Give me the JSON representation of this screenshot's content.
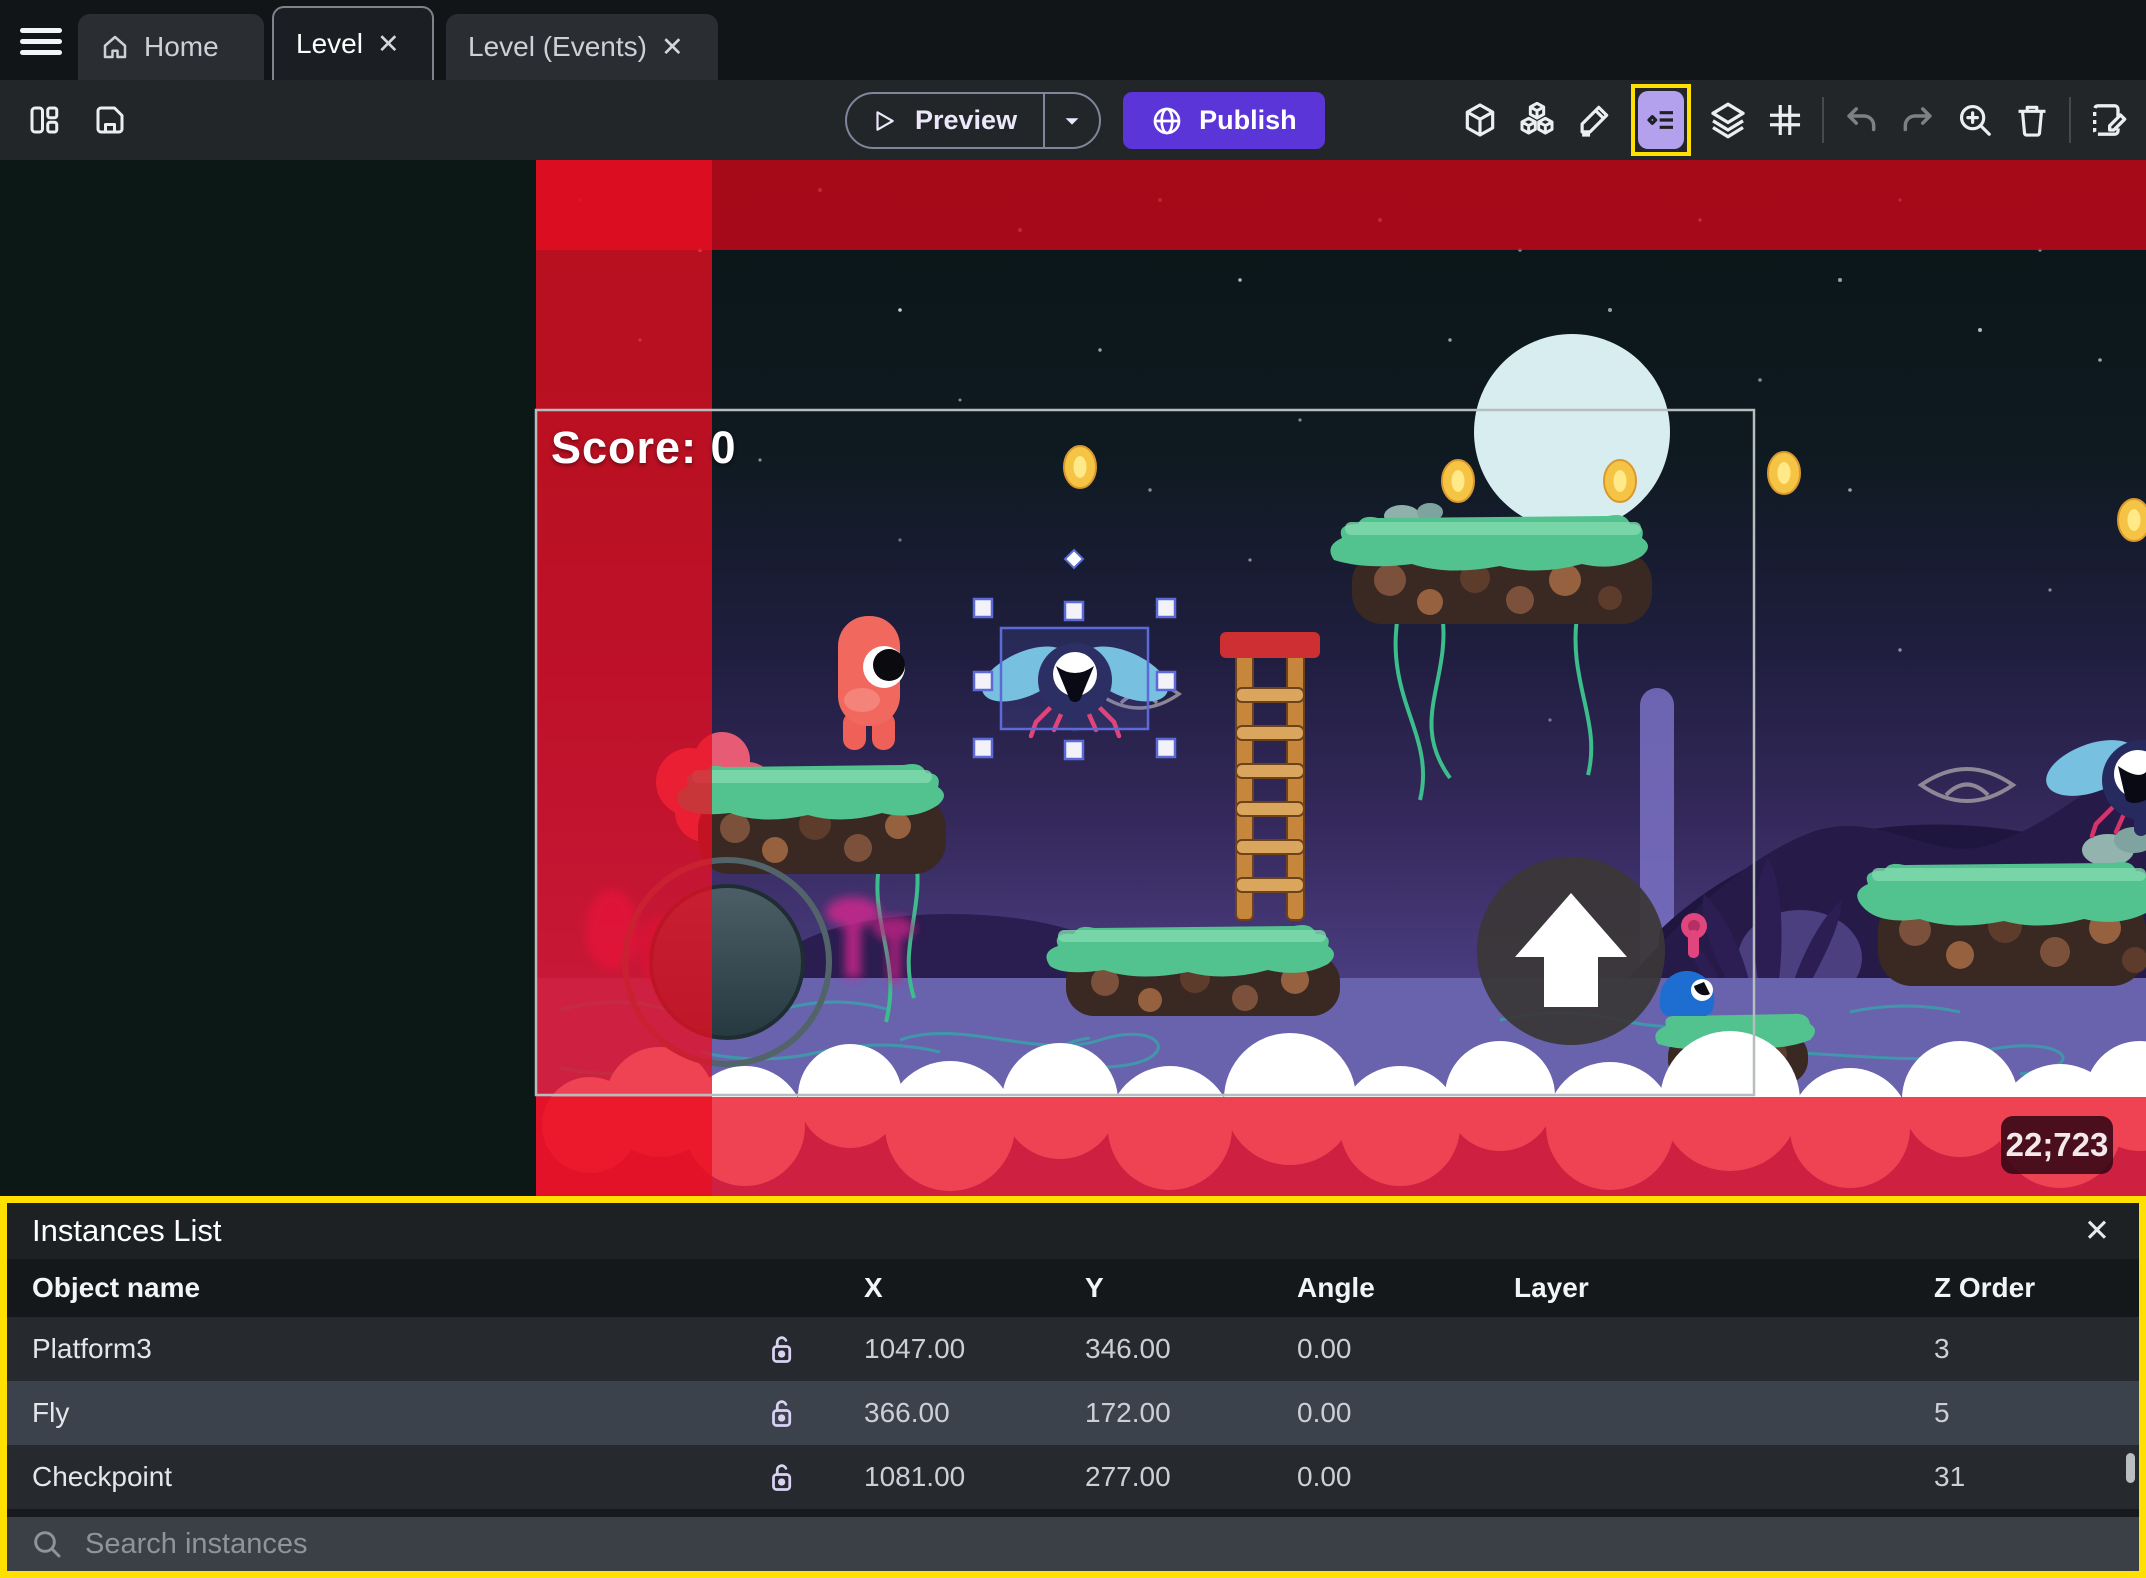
{
  "tabs": {
    "home": "Home",
    "level": "Level",
    "level_events": "Level (Events)"
  },
  "toolbar": {
    "preview_label": "Preview",
    "publish_label": "Publish",
    "right_icons": [
      "cube-icon",
      "instances-cubes-icon",
      "pencil-icon",
      "instances-list-icon",
      "layers-icon",
      "grid-icon",
      "undo-icon",
      "redo-icon",
      "zoom-in-icon",
      "trash-icon",
      "scene-edit-icon"
    ]
  },
  "scene": {
    "score_text": "Score: 0",
    "cursor_coordinates": "22;723"
  },
  "panel": {
    "title": "Instances List",
    "search_placeholder": "Search instances",
    "columns": {
      "name": "Object name",
      "x": "X",
      "y": "Y",
      "angle": "Angle",
      "layer": "Layer",
      "z": "Z Order"
    },
    "rows": [
      {
        "name": "Platform3",
        "x": "1047.00",
        "y": "346.00",
        "angle": "0.00",
        "layer": "",
        "z": "3",
        "selected": false
      },
      {
        "name": "Fly",
        "x": "366.00",
        "y": "172.00",
        "angle": "0.00",
        "layer": "",
        "z": "5",
        "selected": true
      },
      {
        "name": "Checkpoint",
        "x": "1081.00",
        "y": "277.00",
        "angle": "0.00",
        "layer": "",
        "z": "31",
        "selected": false
      }
    ]
  },
  "colors": {
    "highlight_yellow": "#ffe000",
    "publish_purple": "#5b35d8",
    "active_tool_lavender": "#b3a1ee",
    "out_of_bounds_red": "#e10e22",
    "selection_blue": "#5c6ad8",
    "selected_row": "#3b424c"
  }
}
